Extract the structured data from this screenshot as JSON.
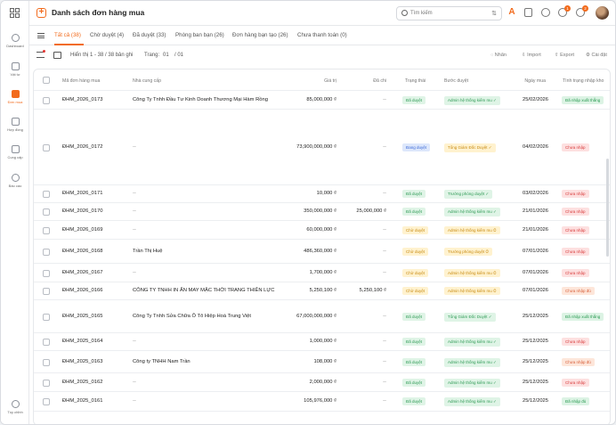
{
  "header": {
    "title": "Danh sách đơn hàng mua",
    "search_placeholder": "Tìm kiếm",
    "notif_badge_1": "1",
    "notif_badge_2": "2"
  },
  "sidebar": {
    "items": [
      {
        "label": "Dashboard",
        "icon": "dashboard-icon"
      },
      {
        "label": "Vật tư",
        "icon": "box-icon"
      },
      {
        "label": "Đơn mua",
        "icon": "order-icon"
      },
      {
        "label": "Hợp đồng",
        "icon": "contract-icon"
      },
      {
        "label": "Cung cấp",
        "icon": "truck-icon"
      },
      {
        "label": "Báo cáo",
        "icon": "report-icon"
      },
      {
        "label": "Tùy chỉnh",
        "icon": "settings-icon"
      }
    ]
  },
  "tabs": [
    {
      "label": "Tất cả (38)"
    },
    {
      "label": "Chờ duyệt (4)"
    },
    {
      "label": "Đã duyệt (33)"
    },
    {
      "label": "Phòng ban bạn (26)"
    },
    {
      "label": "Đơn hàng bạn tạo (26)"
    },
    {
      "label": "Chưa thanh toán (0)"
    }
  ],
  "toolbar": {
    "showing": "Hiển thị 1 - 38 / 38 bản ghi",
    "page_label": "Trang:",
    "page_current": "01",
    "page_total": "/ 01",
    "actions": {
      "label": "Nhãn",
      "import": "Import",
      "export": "Export",
      "settings": "Cài đặt"
    }
  },
  "table": {
    "headers": {
      "code": "Mã đơn hàng mua",
      "supplier": "Nhà cung cấp",
      "value": "Giá trị",
      "paid": "Đã chi",
      "status": "Trạng thái",
      "step": "Bước duyệt",
      "date": "Ngày mua",
      "stock": "Tình trạng nhập kho"
    },
    "rows": [
      {
        "code": "ĐHM_2026_0173",
        "supplier": "Công Ty Tnhh Đầu Tư Kinh Doanh Thương Mại Hàm Rồng",
        "value": "85,000,000 ₫",
        "paid": "--",
        "status": "Đã duyệt",
        "step": "Admin hệ thống kiểm mu ✓",
        "date": "25/02/2026",
        "stock": "Đã nhập xuất thẳng"
      },
      {
        "code": "ĐHM_2026_0172",
        "supplier": "--",
        "value": "73,900,000,000 ₫",
        "paid": "--",
        "status": "Đang duyệt",
        "step": "Tổng Giám Đốc Duyệt ✓",
        "date": "04/02/2026",
        "stock": "Chưa nhập"
      },
      {
        "code": "ĐHM_2026_0171",
        "supplier": "--",
        "value": "10,000 ₫",
        "paid": "--",
        "status": "Đã duyệt",
        "step": "Trưởng phòng duyệt ✓",
        "date": "03/02/2026",
        "stock": "Chưa nhập"
      },
      {
        "code": "ĐHM_2026_0170",
        "supplier": "--",
        "value": "350,000,000 ₫",
        "paid": "25,000,000 ₫",
        "status": "Đã duyệt",
        "step": "Admin hệ thống kiểm mu ✓",
        "date": "21/01/2026",
        "stock": "Chưa nhập"
      },
      {
        "code": "ĐHM_2026_0169",
        "supplier": "--",
        "value": "60,000,000 ₫",
        "paid": "--",
        "status": "Chờ duyệt",
        "step": "Admin hệ thống kiểm mu ⏱",
        "date": "21/01/2026",
        "stock": "Chưa nhập"
      },
      {
        "code": "ĐHM_2026_0168",
        "supplier": "Trần Thị Huệ",
        "value": "486,360,000 ₫",
        "paid": "--",
        "status": "Chờ duyệt",
        "step": "Trưởng phòng duyệt ⏱",
        "date": "07/01/2026",
        "stock": "Chưa nhập"
      },
      {
        "code": "ĐHM_2026_0167",
        "supplier": "--",
        "value": "1,700,000 ₫",
        "paid": "--",
        "status": "Chờ duyệt",
        "step": "Admin hệ thống kiểm mu ⏱",
        "date": "07/01/2026",
        "stock": "Chưa nhập"
      },
      {
        "code": "ĐHM_2026_0166",
        "supplier": "CÔNG TY TNHH IN ẤN MAY MẶC THỜI TRANG THIÊN LỰC",
        "value": "5,250,100 ₫",
        "paid": "5,250,100 ₫",
        "status": "Chờ duyệt",
        "step": "Admin hệ thống kiểm mu ⏱",
        "date": "07/01/2026",
        "stock": "Chưa nhập đủ"
      },
      {
        "code": "ĐHM_2025_0165",
        "supplier": "Công Ty Tnhh Sửa Chữa Ô Tô Hiệp Hoà Trung Việt",
        "value": "67,000,000,000 ₫",
        "paid": "--",
        "status": "Đã duyệt",
        "step": "Tổng Giám Đốc Duyệt ✓",
        "date": "25/12/2025",
        "stock": "Đã nhập xuất thẳng"
      },
      {
        "code": "ĐHM_2025_0164",
        "supplier": "--",
        "value": "1,000,000 ₫",
        "paid": "--",
        "status": "Đã duyệt",
        "step": "Admin hệ thống kiểm mu ✓",
        "date": "25/12/2025",
        "stock": "Chưa nhập"
      },
      {
        "code": "ĐHM_2025_0163",
        "supplier": "Công ty TNHH Nam Trần",
        "value": "108,000 ₫",
        "paid": "--",
        "status": "Đã duyệt",
        "step": "Admin hệ thống kiểm mu ✓",
        "date": "25/12/2025",
        "stock": "Chưa nhập đủ"
      },
      {
        "code": "ĐHM_2025_0162",
        "supplier": "--",
        "value": "2,000,000 ₫",
        "paid": "--",
        "status": "Đã duyệt",
        "step": "Admin hệ thống kiểm mu ✓",
        "date": "25/12/2025",
        "stock": "Chưa nhập"
      },
      {
        "code": "ĐHM_2025_0161",
        "supplier": "--",
        "value": "105,976,000 ₫",
        "paid": "--",
        "status": "Đã duyệt",
        "step": "Admin hệ thống kiểm mu ✓",
        "date": "25/12/2025",
        "stock": "Đã nhập đủ"
      }
    ]
  },
  "colors": {
    "accent": "#f26b1d"
  }
}
